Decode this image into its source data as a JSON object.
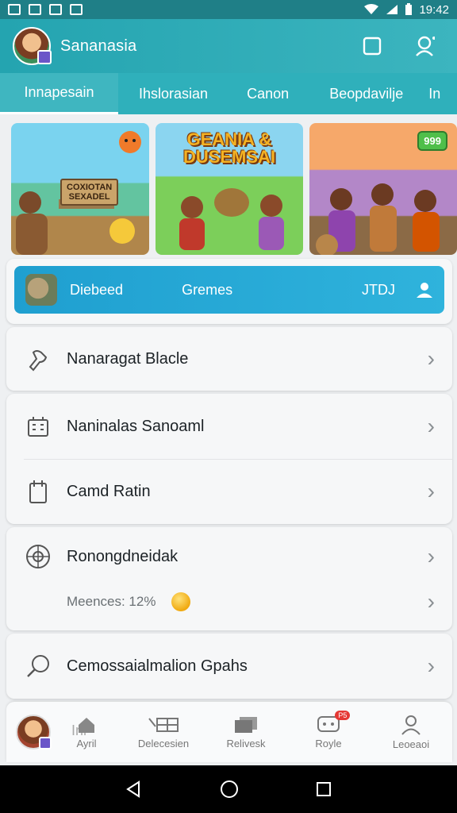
{
  "status_bar": {
    "time": "19:42"
  },
  "app_bar": {
    "title": "Sananasia"
  },
  "tabs": [
    {
      "label": "Innapesain",
      "active": true
    },
    {
      "label": "Ihslorasian",
      "active": false
    },
    {
      "label": "Canon",
      "active": false
    },
    {
      "label": "Beopdavilje",
      "active": false
    },
    {
      "label": "In",
      "active": false
    }
  ],
  "banners": [
    {
      "sign": "COXIOTAN\nSEXADEL"
    },
    {
      "title": "GEANIA &\nDUSEMSAI"
    },
    {
      "badge": "999"
    }
  ],
  "promo": {
    "left": "Diebeed",
    "center": "Gremes",
    "right": "JTDJ"
  },
  "menu": {
    "item1": "Nanaragat Blacle",
    "item2": "Naninalas Sanoaml",
    "item3": "Camd Ratin",
    "item4": "Ronongdneidak",
    "item4_sub": "Meences: 12%",
    "item5": "Cemossaialmalion Gpahs"
  },
  "bottom_nav": {
    "ghost": "Inr",
    "items": [
      {
        "label": "Ayril",
        "icon": "home-icon"
      },
      {
        "label": "Delecesien",
        "icon": "grid-icon"
      },
      {
        "label": "Relivesk",
        "icon": "cards-icon"
      },
      {
        "label": "Royle",
        "icon": "chat-icon",
        "badge": "P5"
      },
      {
        "label": "Leoeaoi",
        "icon": "person-icon"
      }
    ]
  },
  "colors": {
    "primary": "#2fb0bb",
    "promo": "#1f9fd0"
  }
}
